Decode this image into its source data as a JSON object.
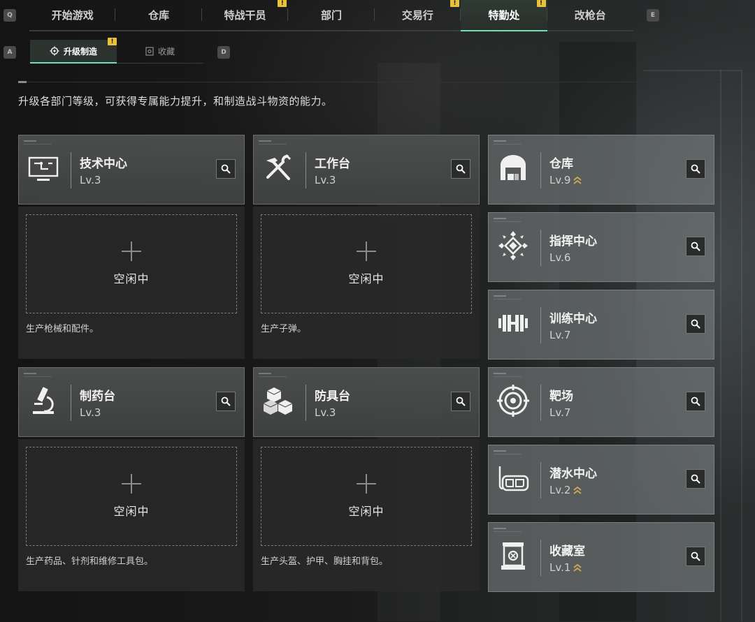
{
  "hotkeys": {
    "prev_tab": "Q",
    "next_tab": "E",
    "prev_sub": "A",
    "next_sub": "D"
  },
  "top_tabs": [
    {
      "label": "开始游戏",
      "alert": false
    },
    {
      "label": "仓库",
      "alert": false
    },
    {
      "label": "特战干员",
      "alert": true
    },
    {
      "label": "部门",
      "alert": false
    },
    {
      "label": "交易行",
      "alert": true
    },
    {
      "label": "特勤处",
      "alert": true,
      "active": true
    },
    {
      "label": "改枪台",
      "alert": false
    }
  ],
  "alert_mark": "!",
  "sub_tabs": [
    {
      "label": "升级制造",
      "active": true,
      "alert": true
    },
    {
      "label": "收藏",
      "active": false,
      "alert": false
    }
  ],
  "description": "升级各部门等级，可获得专属能力提升，和制造战斗物资的能力。",
  "production_facilities": [
    {
      "name": "技术中心",
      "level": "Lv.3",
      "icon": "computer-icon",
      "slot": "空闲中",
      "desc": "生产枪械和配件。"
    },
    {
      "name": "工作台",
      "level": "Lv.3",
      "icon": "tools-icon",
      "slot": "空闲中",
      "desc": "生产子弹。"
    },
    {
      "name": "制药台",
      "level": "Lv.3",
      "icon": "microscope-icon",
      "slot": "空闲中",
      "desc": "生产药品、针剂和维修工具包。"
    },
    {
      "name": "防具台",
      "level": "Lv.3",
      "icon": "cubes-icon",
      "slot": "空闲中",
      "desc": "生产头盔、护甲、胸挂和背包。"
    }
  ],
  "departments": [
    {
      "name": "仓库",
      "level": "Lv.9",
      "upgrade": true,
      "icon": "warehouse-icon"
    },
    {
      "name": "指挥中心",
      "level": "Lv.6",
      "upgrade": false,
      "icon": "emblem-icon"
    },
    {
      "name": "训练中心",
      "level": "Lv.7",
      "upgrade": false,
      "icon": "dumbbell-icon"
    },
    {
      "name": "靶场",
      "level": "Lv.7",
      "upgrade": false,
      "icon": "target-icon"
    },
    {
      "name": "潜水中心",
      "level": "Lv.2",
      "upgrade": true,
      "icon": "diving-mask-icon"
    },
    {
      "name": "收藏室",
      "level": "Lv.1",
      "upgrade": true,
      "icon": "display-case-icon"
    }
  ],
  "colors": {
    "accent": "#6fe0b5",
    "alert": "#e8c23a",
    "upgrade": "#c8a85a"
  }
}
